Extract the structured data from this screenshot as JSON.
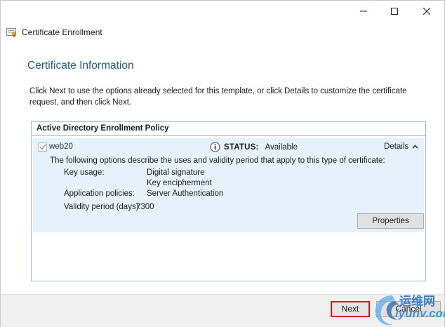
{
  "window": {
    "title": "Certificate Enrollment",
    "controls": {
      "minimize": "minimize",
      "maximize": "maximize",
      "close": "close"
    }
  },
  "page": {
    "title": "Certificate Information",
    "intro": "Click Next to use the options already selected for this template, or click Details to customize the certificate request, and then click Next."
  },
  "policy": {
    "header": "Active Directory Enrollment Policy",
    "certificate": {
      "name": "web20",
      "checked": true,
      "status_label": "STATUS:",
      "status_value": "Available",
      "details_label": "Details",
      "description": "The following options describe the uses and validity period that apply to this type of certificate:",
      "properties": [
        {
          "label": "Key usage:",
          "values": [
            "Digital signature",
            "Key encipherment"
          ]
        },
        {
          "label": "Application policies:",
          "values": [
            "Server Authentication"
          ]
        },
        {
          "label": "Validity period (days):",
          "values": [
            "7300"
          ]
        }
      ],
      "properties_button": "Properties"
    }
  },
  "footer": {
    "next_label": "Next",
    "cancel_label": "Cancel",
    "next_highlight_color": "#d9141b"
  },
  "watermark": {
    "line1": "运维网",
    "line2": "iyunv.com"
  },
  "colors": {
    "title_blue": "#1c5a9c",
    "panel_bg": "#e5f1fb",
    "footer_bg": "#f0f0f0"
  }
}
